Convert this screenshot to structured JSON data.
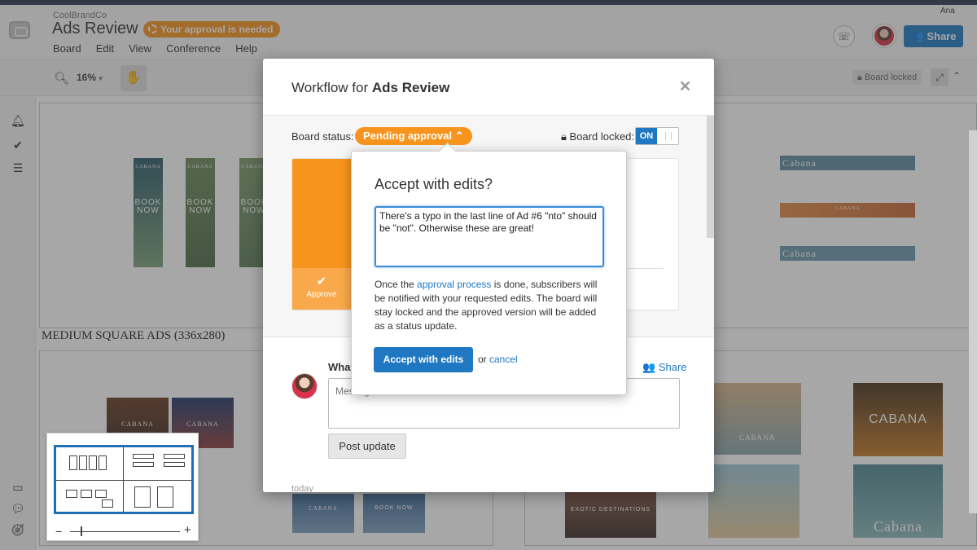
{
  "header": {
    "company": "CoolBrandCo",
    "board_title": "Ads Review",
    "approval_badge": "Your approval is needed",
    "user_name": "Ana",
    "share_label": "Share",
    "menu": [
      "Board",
      "Edit",
      "View",
      "Conference",
      "Help"
    ]
  },
  "toolbar": {
    "zoom": "16%",
    "locked_chip": "Board locked"
  },
  "canvas": {
    "section_label": "MEDIUM SQUARE ADS (336x280)",
    "skyscraper_ads": [
      {
        "brand": "CABANA",
        "cta": "BOOK NOW"
      },
      {
        "brand": "CABANA",
        "cta": "BOOK NOW"
      },
      {
        "brand": "CABANA",
        "cta": "BOOK NOW"
      }
    ],
    "banner_ads": [
      "Cabana",
      "CABANA",
      "Cabana"
    ],
    "square_ads": [
      "CABANA",
      "CABANA",
      "CABANA",
      "CABANA",
      "Cabana"
    ],
    "lower_ads": [
      "CABANA",
      "BOOK NOW",
      "CABANA"
    ],
    "exotic_text": "EXOTIC DESTINATIONS"
  },
  "modal": {
    "title_prefix": "Workflow for",
    "title_board": "Ads Review",
    "board_status_label": "Board status:",
    "status_pill": "Pending approval",
    "board_locked_label": "Board locked:",
    "toggle_on": "ON",
    "approve_label": "Approve",
    "post_prompt": "What",
    "post_share": "Share",
    "post_placeholder": "Message",
    "post_button": "Post update",
    "today": "today"
  },
  "popover": {
    "title": "Accept with edits?",
    "textarea_value": "There's a typo in the last line of Ad #6 \"nto\" should be \"not\". Otherwise these are great!",
    "desc_before": "Once the ",
    "desc_link": "approval process",
    "desc_after": " is done, subscribers will be notified with your requested edits. The board will stay locked and the approved version will be added as a status update.",
    "accept_button": "Accept with edits",
    "or_text": "or",
    "cancel_link": "cancel"
  },
  "colors": {
    "accent_blue": "#1f78c1",
    "warning_orange": "#f7941d",
    "navy_topbar": "#2b3a55"
  }
}
